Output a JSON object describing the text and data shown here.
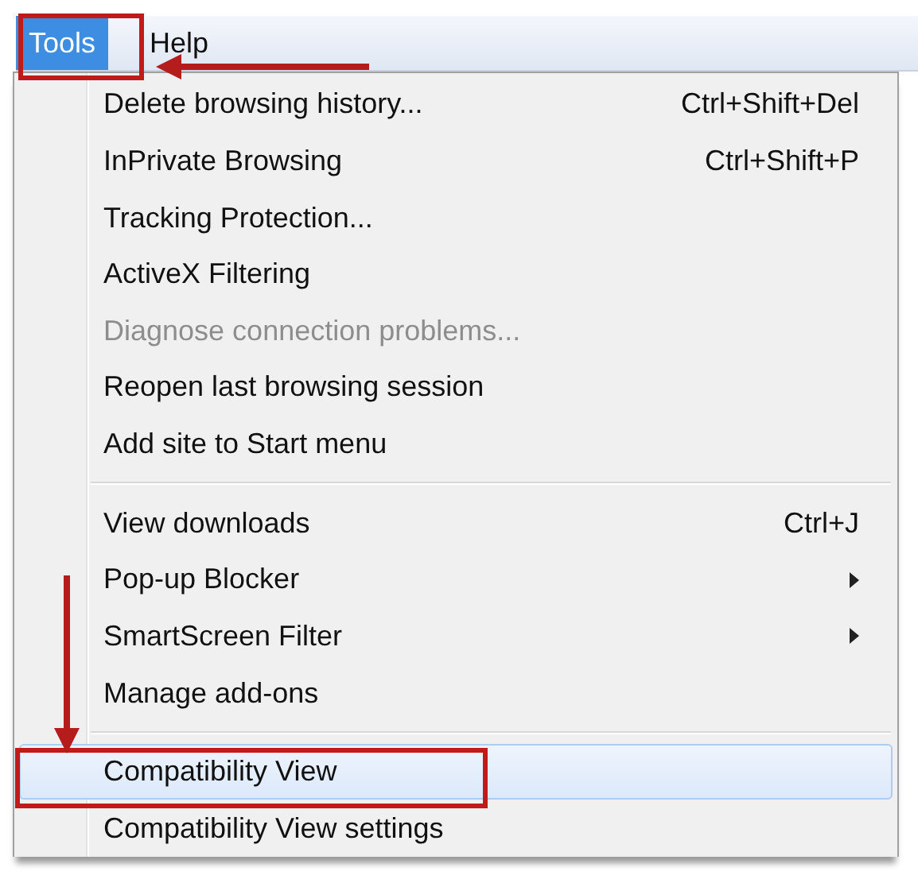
{
  "menubar": [
    {
      "label": "Tools",
      "selected": true
    },
    {
      "label": "Help",
      "selected": false
    }
  ],
  "menu": {
    "items": [
      {
        "kind": "item",
        "label": "Delete browsing history...",
        "shortcut": "Ctrl+Shift+Del",
        "disabled": false,
        "submenu": false,
        "selected": false
      },
      {
        "kind": "item",
        "label": "InPrivate Browsing",
        "shortcut": "Ctrl+Shift+P",
        "disabled": false,
        "submenu": false,
        "selected": false
      },
      {
        "kind": "item",
        "label": "Tracking Protection...",
        "disabled": false,
        "submenu": false,
        "selected": false
      },
      {
        "kind": "item",
        "label": "ActiveX Filtering",
        "disabled": false,
        "submenu": false,
        "selected": false
      },
      {
        "kind": "item",
        "label": "Diagnose connection problems...",
        "disabled": true,
        "submenu": false,
        "selected": false
      },
      {
        "kind": "item",
        "label": "Reopen last browsing session",
        "disabled": false,
        "submenu": false,
        "selected": false
      },
      {
        "kind": "item",
        "label": "Add site to Start menu",
        "disabled": false,
        "submenu": false,
        "selected": false
      },
      {
        "kind": "separator"
      },
      {
        "kind": "item",
        "label": "View downloads",
        "shortcut": "Ctrl+J",
        "disabled": false,
        "submenu": false,
        "selected": false
      },
      {
        "kind": "item",
        "label": "Pop-up Blocker",
        "disabled": false,
        "submenu": true,
        "selected": false
      },
      {
        "kind": "item",
        "label": "SmartScreen Filter",
        "disabled": false,
        "submenu": true,
        "selected": false
      },
      {
        "kind": "item",
        "label": "Manage add-ons",
        "disabled": false,
        "submenu": false,
        "selected": false
      },
      {
        "kind": "separator"
      },
      {
        "kind": "item",
        "label": "Compatibility View",
        "disabled": false,
        "submenu": false,
        "selected": true
      },
      {
        "kind": "item",
        "label": "Compatibility View settings",
        "disabled": false,
        "submenu": false,
        "selected": false
      }
    ]
  }
}
